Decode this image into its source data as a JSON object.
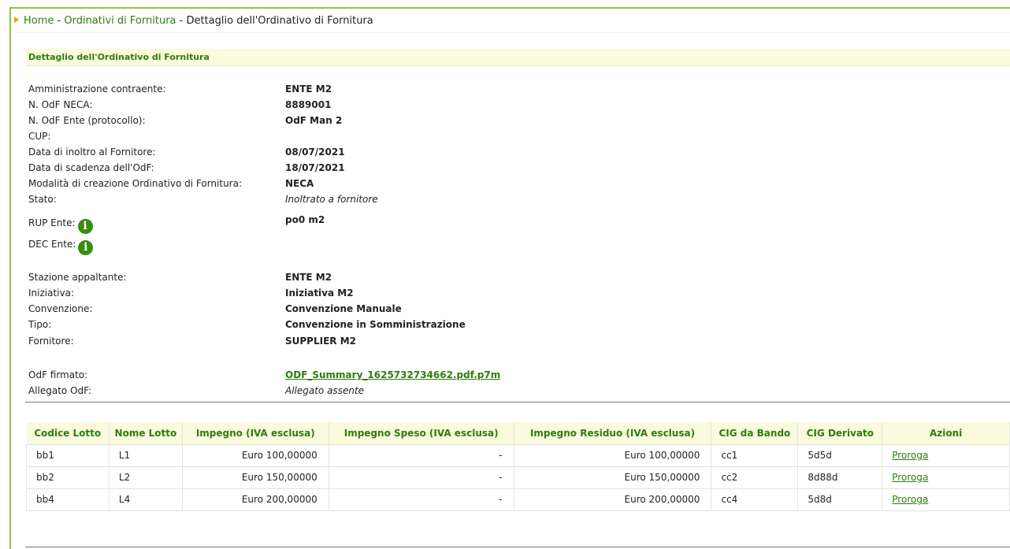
{
  "breadcrumb": {
    "home": "Home",
    "sep": " - ",
    "ordinativi": "Ordinativi di Fornitura",
    "current": "Dettaglio dell'Ordinativo di Fornitura"
  },
  "section": {
    "title": "Dettaglio dell'Ordinativo di Fornitura"
  },
  "details": {
    "amministrazione": {
      "label": "Amministrazione contraente:",
      "value": "ENTE M2"
    },
    "n_odf_neca": {
      "label": "N. OdF NECA:",
      "value": "8889001"
    },
    "n_odf_ente": {
      "label": "N. OdF Ente (protocollo):",
      "value": "OdF Man 2"
    },
    "cup": {
      "label": "CUP:",
      "value": ""
    },
    "data_inoltro": {
      "label": "Data di inoltro al Fornitore:",
      "value": "08/07/2021"
    },
    "data_scadenza": {
      "label": "Data di scadenza dell'OdF:",
      "value": "18/07/2021"
    },
    "modalita": {
      "label": "Modalità di creazione Ordinativo di Fornitura:",
      "value": "NECA"
    },
    "stato": {
      "label": "Stato:",
      "value": "Inoltrato a fornitore"
    },
    "rup": {
      "label": "RUP Ente:",
      "value": "po0 m2"
    },
    "dec": {
      "label": "DEC Ente:",
      "value": ""
    },
    "stazione": {
      "label": "Stazione appaltante:",
      "value": "ENTE M2"
    },
    "iniziativa": {
      "label": "Iniziativa:",
      "value": "Iniziativa M2"
    },
    "convenzione": {
      "label": "Convenzione:",
      "value": "Convenzione Manuale"
    },
    "tipo": {
      "label": "Tipo:",
      "value": "Convenzione in Somministrazione"
    },
    "fornitore": {
      "label": "Fornitore:",
      "value": "SUPPLIER M2"
    },
    "odf_firmato": {
      "label": "OdF firmato:",
      "value": "ODF_Summary_1625732734662.pdf.p7m"
    },
    "allegato": {
      "label": "Allegato OdF:",
      "value": "Allegato assente"
    }
  },
  "info_icon_glyph": "i",
  "table": {
    "headers": [
      "Codice Lotto",
      "Nome Lotto",
      "Impegno (IVA esclusa)",
      "Impegno Speso (IVA esclusa)",
      "Impegno Residuo (IVA esclusa)",
      "CIG da Bando",
      "CIG Derivato",
      "Azioni"
    ],
    "rows": [
      {
        "codice": "bb1",
        "nome": "L1",
        "impegno": "Euro  100,00000",
        "speso": "-",
        "residuo": "Euro  100,00000",
        "cig_bando": "cc1",
        "cig_derivato": "5d5d",
        "azione": "Proroga"
      },
      {
        "codice": "bb2",
        "nome": "L2",
        "impegno": "Euro  150,00000",
        "speso": "-",
        "residuo": "Euro  150,00000",
        "cig_bando": "cc2",
        "cig_derivato": "8d88d",
        "azione": "Proroga"
      },
      {
        "codice": "bb4",
        "nome": "L4",
        "impegno": "Euro  200,00000",
        "speso": "-",
        "residuo": "Euro  200,00000",
        "cig_bando": "cc4",
        "cig_derivato": "5d8d",
        "azione": "Proroga"
      }
    ]
  },
  "colors": {
    "accent": "#2e7d0f",
    "border": "#8dc63f",
    "header_bg": "#fafadc",
    "icon": "#3a8a11"
  }
}
